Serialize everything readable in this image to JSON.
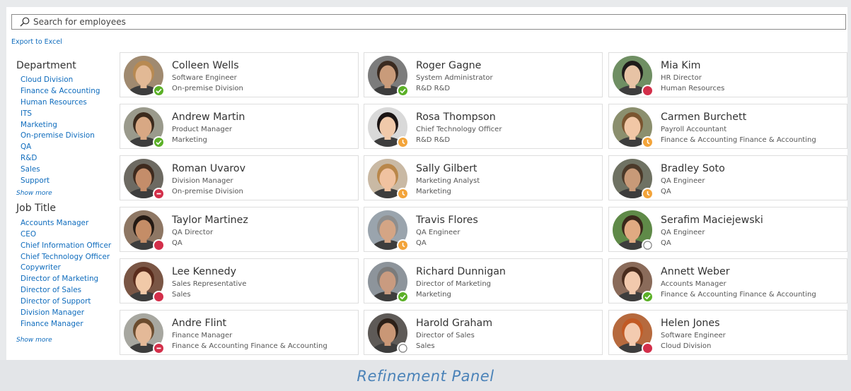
{
  "search": {
    "placeholder": "Search for employees"
  },
  "export_label": "Export to Excel",
  "sidebar": {
    "department": {
      "title": "Department",
      "items": [
        "Cloud Division",
        "Finance & Accounting",
        "Human Resources",
        "ITS",
        "Marketing",
        "On-premise Division",
        "QA",
        "R&D",
        "Sales",
        "Support"
      ],
      "show_more": "Show more"
    },
    "job_title": {
      "title": "Job Title",
      "items": [
        "Accounts Manager",
        "CEO",
        "Chief Information Officer",
        "Chief Technology Officer",
        "Copywriter",
        "Director of Marketing",
        "Director of Sales",
        "Director of Support",
        "Division Manager",
        "Finance Manager"
      ],
      "show_more": "Show more"
    }
  },
  "employees": [
    {
      "name": "Colleen Wells",
      "title": "Software Engineer",
      "dept": "On-premise Division",
      "status": "available",
      "skin": "#e2b995",
      "hair": "#b88a52",
      "bg": "#a08a70"
    },
    {
      "name": "Roger Gagne",
      "title": "System Administrator",
      "dept": "R&D R&D",
      "status": "available",
      "skin": "#c99b7a",
      "hair": "#3a2a20",
      "bg": "#7c7c7c"
    },
    {
      "name": "Mia Kim",
      "title": "HR Director",
      "dept": "Human Resources",
      "status": "busy",
      "skin": "#e7c3a5",
      "hair": "#1e1b1a",
      "bg": "#6f8f63"
    },
    {
      "name": "Andrew Martin",
      "title": "Product Manager",
      "dept": "Marketing",
      "status": "available",
      "skin": "#d8a884",
      "hair": "#3b2a1d",
      "bg": "#9a9a8c"
    },
    {
      "name": "Rosa Thompson",
      "title": "Chief Technology Officer",
      "dept": "R&D R&D",
      "status": "away",
      "skin": "#f0c9aa",
      "hair": "#1a1414",
      "bg": "#d9d9d9"
    },
    {
      "name": "Carmen Burchett",
      "title": "Payroll Accountant",
      "dept": "Finance & Accounting Finance & Accounting",
      "status": "away",
      "skin": "#f1c7a6",
      "hair": "#7a5530",
      "bg": "#8b8f6e"
    },
    {
      "name": "Roman Uvarov",
      "title": "Division Manager",
      "dept": "On-premise Division",
      "status": "busy",
      "skin": "#c48d6a",
      "hair": "#3e2a1e",
      "bg": "#6d6a62"
    },
    {
      "name": "Sally Gilbert",
      "title": "Marketing Analyst",
      "dept": "Marketing",
      "status": "away",
      "skin": "#f0c2a0",
      "hair": "#b9874a",
      "bg": "#c9b9a4"
    },
    {
      "name": "Bradley Soto",
      "title": "QA Engineer",
      "dept": "QA",
      "status": "away",
      "skin": "#c89a78",
      "hair": "#4b3a2a",
      "bg": "#6f7263"
    },
    {
      "name": "Taylor Martinez",
      "title": "QA Director",
      "dept": "QA",
      "status": "busy",
      "skin": "#c48d67",
      "hair": "#241a14",
      "bg": "#8e7764"
    },
    {
      "name": "Travis Flores",
      "title": "QA Engineer",
      "dept": "QA",
      "status": "away",
      "skin": "#d4a585",
      "hair": "#8e8e8e",
      "bg": "#9aa4ad"
    },
    {
      "name": "Serafim Maciejewski",
      "title": "QA Engineer",
      "dept": "QA",
      "status": "offline",
      "skin": "#e0aa82",
      "hair": "#3a281b",
      "bg": "#5f8a48"
    },
    {
      "name": "Lee Kennedy",
      "title": "Sales Representative",
      "dept": "Sales",
      "status": "busy",
      "skin": "#f1c9a8",
      "hair": "#5a2c1c",
      "bg": "#7a5645"
    },
    {
      "name": "Richard Dunnigan",
      "title": "Director of Marketing",
      "dept": "Marketing",
      "status": "available",
      "skin": "#c99b80",
      "hair": "#7b7b7b",
      "bg": "#8d949b"
    },
    {
      "name": "Annett Weber",
      "title": "Accounts Manager",
      "dept": "Finance & Accounting Finance & Accounting",
      "status": "available",
      "skin": "#f2c9ad",
      "hair": "#4a2c1d",
      "bg": "#8a6b5a"
    },
    {
      "name": "Andre Flint",
      "title": "Finance Manager",
      "dept": "Finance & Accounting Finance & Accounting",
      "status": "busy",
      "skin": "#e4b998",
      "hair": "#6b4c2f",
      "bg": "#a7a7a0"
    },
    {
      "name": "Harold Graham",
      "title": "Director of Sales",
      "dept": "Sales",
      "status": "offline",
      "skin": "#c99776",
      "hair": "#2c2018",
      "bg": "#5e5a57"
    },
    {
      "name": "Helen Jones",
      "title": "Software Engineer",
      "dept": "Cloud Division",
      "status": "busy",
      "skin": "#f3cbb0",
      "hair": "#c25a24",
      "bg": "#b66a3e"
    }
  ],
  "footer_label": "Refinement Panel",
  "colors": {
    "link": "#0f6cbd",
    "available": "#5bb027",
    "away": "#f3a43a",
    "busy": "#d32f4a"
  }
}
